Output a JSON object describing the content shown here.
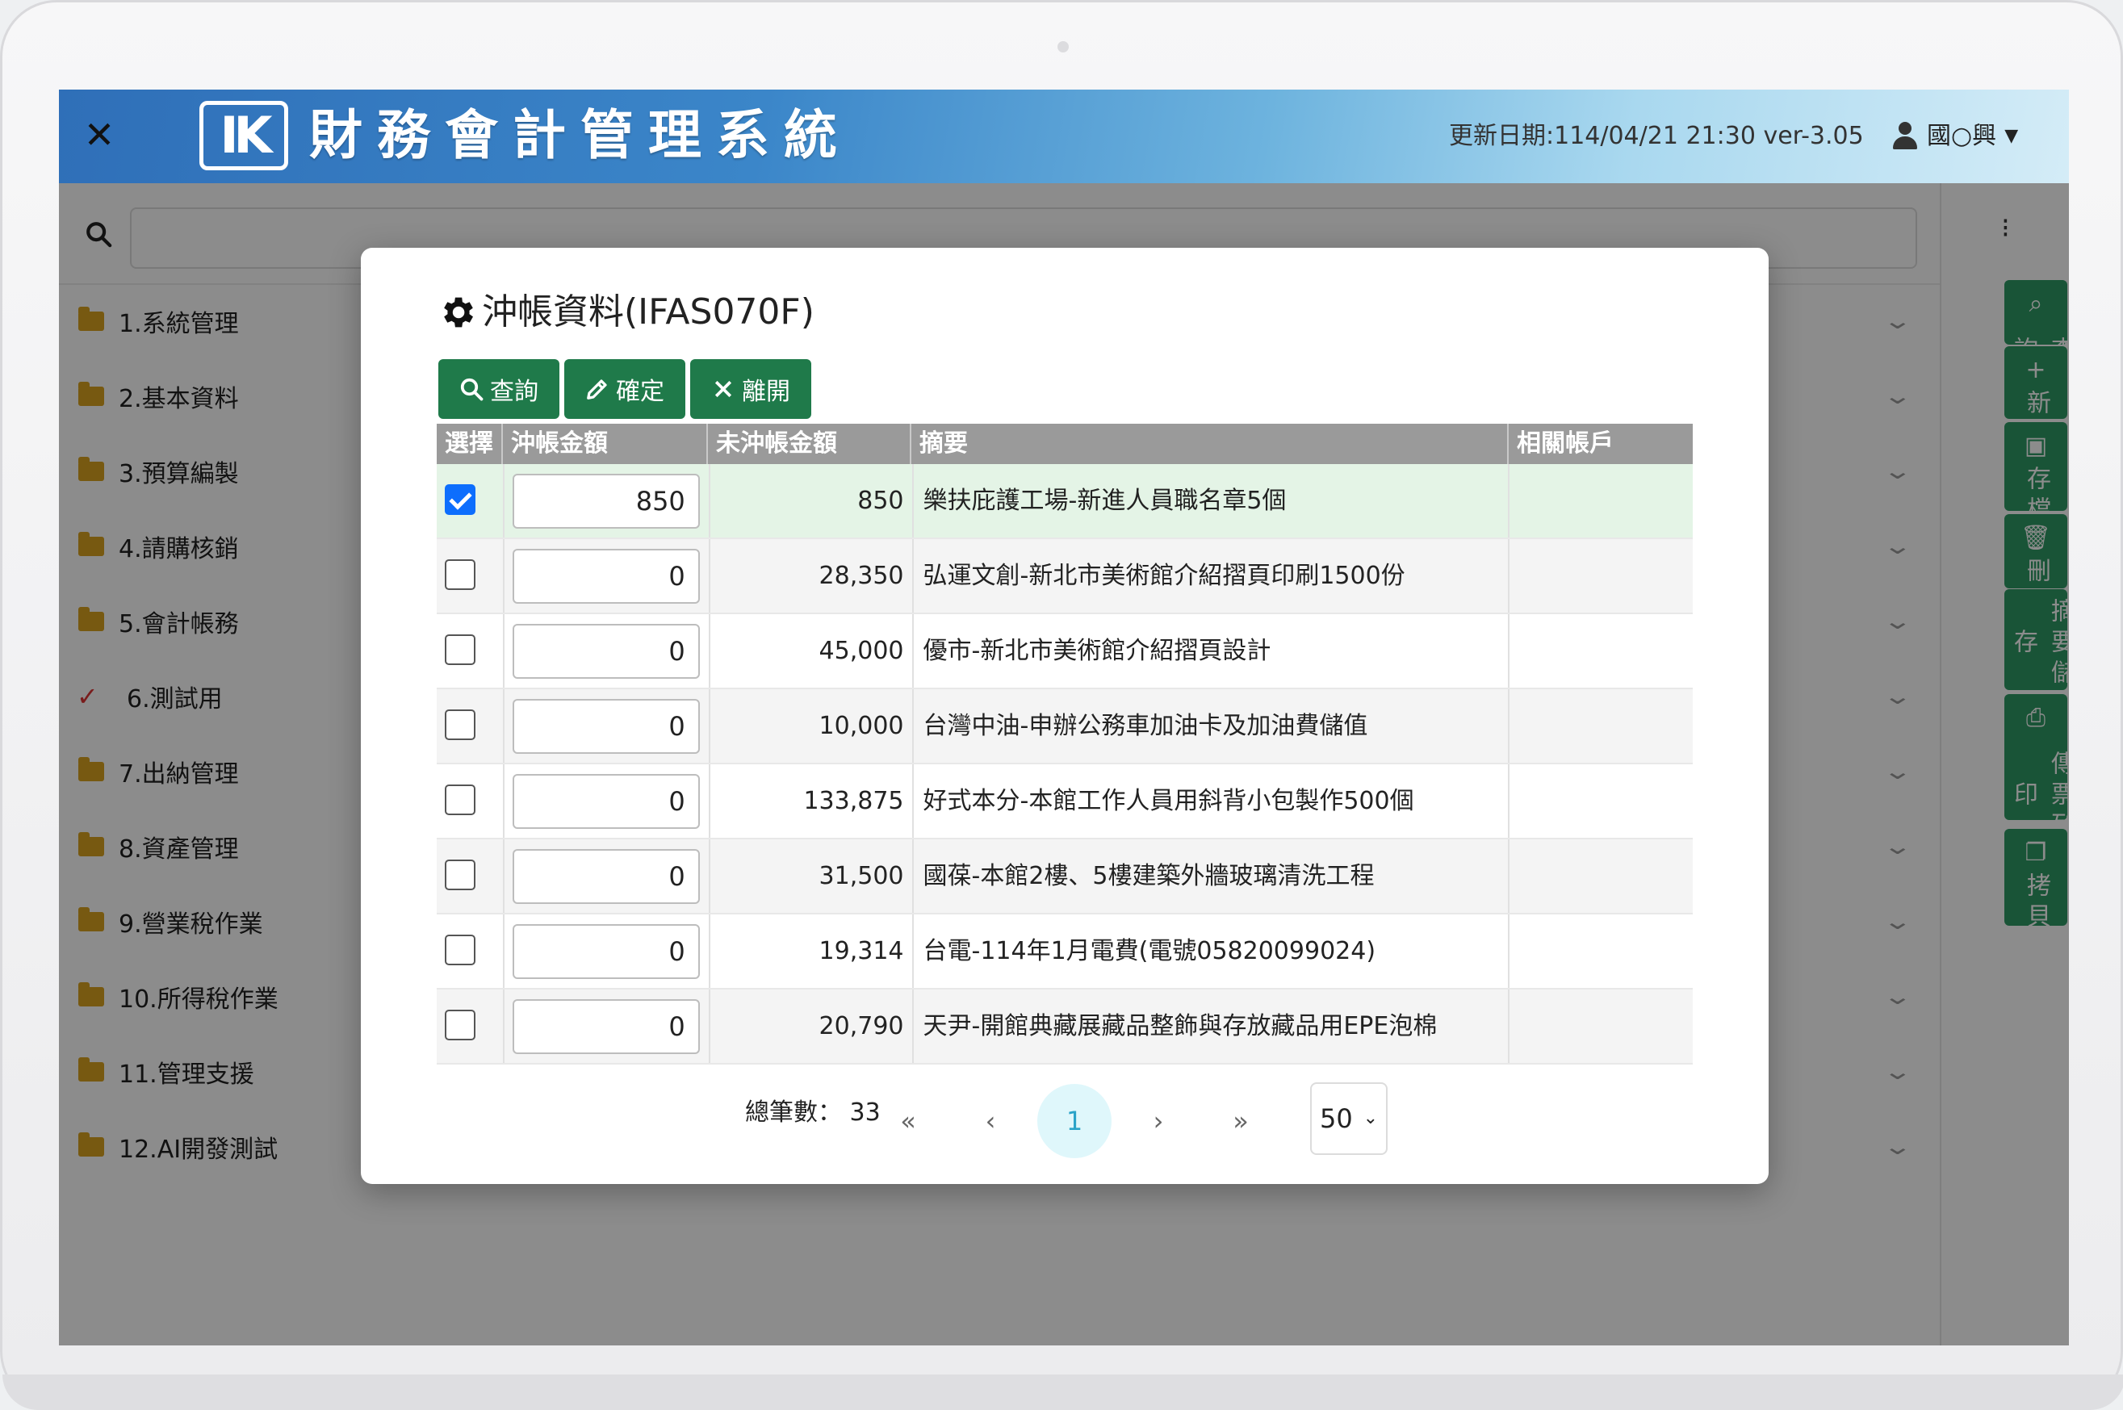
{
  "header": {
    "logo_text": "IK",
    "app_title": "財務會計管理系統",
    "update_date": "更新日期:114/04/21 21:30 ver-3.05",
    "user_name": "國○興"
  },
  "sidebar": {
    "items": [
      {
        "label": "1.系統管理",
        "icon": "folder-icon"
      },
      {
        "label": "2.基本資料",
        "icon": "folder-icon"
      },
      {
        "label": "3.預算編製",
        "icon": "folder-icon"
      },
      {
        "label": "4.請購核銷",
        "icon": "folder-icon"
      },
      {
        "label": "5.會計帳務",
        "icon": "folder-icon"
      },
      {
        "label": "6.測試用",
        "icon": "check-icon"
      },
      {
        "label": "7.出納管理",
        "icon": "folder-icon"
      },
      {
        "label": "8.資產管理",
        "icon": "folder-icon"
      },
      {
        "label": "9.營業稅作業",
        "icon": "folder-icon"
      },
      {
        "label": "10.所得稅作業",
        "icon": "folder-icon"
      },
      {
        "label": "11.管理支援",
        "icon": "folder-icon"
      },
      {
        "label": "12.AI開發測試",
        "icon": "folder-icon"
      }
    ]
  },
  "rail": {
    "buttons": [
      {
        "label": "查詢",
        "icon": "search-icon"
      },
      {
        "label": "新增",
        "icon": "plus-icon"
      },
      {
        "label": "存檔",
        "icon": "save-icon"
      },
      {
        "label": "刪除",
        "icon": "trash-icon"
      },
      {
        "label": "摘要儲存",
        "icon": ""
      },
      {
        "label": "傳票列印",
        "icon": "print-icon"
      },
      {
        "label": "拷貝",
        "icon": "copy-icon"
      }
    ]
  },
  "modal": {
    "title": "沖帳資料(IFAS070F)",
    "toolbar": {
      "query_label": "查詢",
      "confirm_label": "確定",
      "leave_label": "離開"
    },
    "columns": [
      "選擇",
      "沖帳金額",
      "未沖帳金額",
      "摘要",
      "相關帳戶"
    ],
    "rows": [
      {
        "selected": true,
        "amount": "850",
        "unsettled": "850",
        "summary": "樂扶庇護工場-新進人員職名章5個",
        "account": ""
      },
      {
        "selected": false,
        "amount": "0",
        "unsettled": "28,350",
        "summary": "弘運文創-新北市美術館介紹摺頁印刷1500份",
        "account": ""
      },
      {
        "selected": false,
        "amount": "0",
        "unsettled": "45,000",
        "summary": "優市-新北市美術館介紹摺頁設計",
        "account": ""
      },
      {
        "selected": false,
        "amount": "0",
        "unsettled": "10,000",
        "summary": "台灣中油-申辦公務車加油卡及加油費儲值",
        "account": ""
      },
      {
        "selected": false,
        "amount": "0",
        "unsettled": "133,875",
        "summary": "好式本分-本館工作人員用斜背小包製作500個",
        "account": ""
      },
      {
        "selected": false,
        "amount": "0",
        "unsettled": "31,500",
        "summary": "國葆-本館2樓、5樓建築外牆玻璃清洗工程",
        "account": ""
      },
      {
        "selected": false,
        "amount": "0",
        "unsettled": "19,314",
        "summary": "台電-114年1月電費(電號05820099024)",
        "account": ""
      },
      {
        "selected": false,
        "amount": "0",
        "unsettled": "20,790",
        "summary": "天尹-開館典藏展藏品整飾與存放藏品用EPE泡棉",
        "account": ""
      }
    ],
    "pager": {
      "total_label": "總筆數：",
      "total": "33",
      "first": "«",
      "prev": "‹",
      "current": "1",
      "next": "›",
      "last": "»",
      "page_size": "50"
    }
  },
  "colors": {
    "accent_green": "#1f7a4a",
    "rail_green": "#2e9a64",
    "checkbox_blue": "#0d6efd",
    "selected_row": "#e4f4e6"
  }
}
